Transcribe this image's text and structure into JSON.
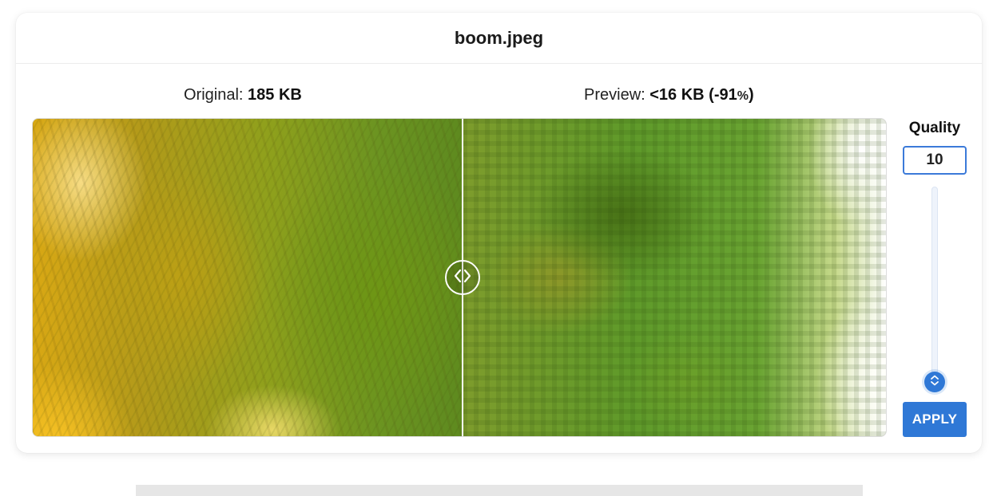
{
  "file": {
    "name": "boom.jpeg"
  },
  "sizes": {
    "original_label": "Original: ",
    "original_value": "185 KB",
    "preview_label": "Preview: ",
    "preview_value": "<16 KB (-91",
    "preview_pct_sign": "%",
    "preview_close": ")"
  },
  "compare": {
    "divider_icon": "chevron-left-right-icon",
    "divider_position": 0.503
  },
  "quality": {
    "label": "Quality",
    "value": "10",
    "slider_icon": "chevron-up-down-icon",
    "slider_value": 10,
    "apply_label": "APPLY"
  },
  "colors": {
    "accent": "#2f78d6",
    "input_border": "#3b7ad9"
  }
}
